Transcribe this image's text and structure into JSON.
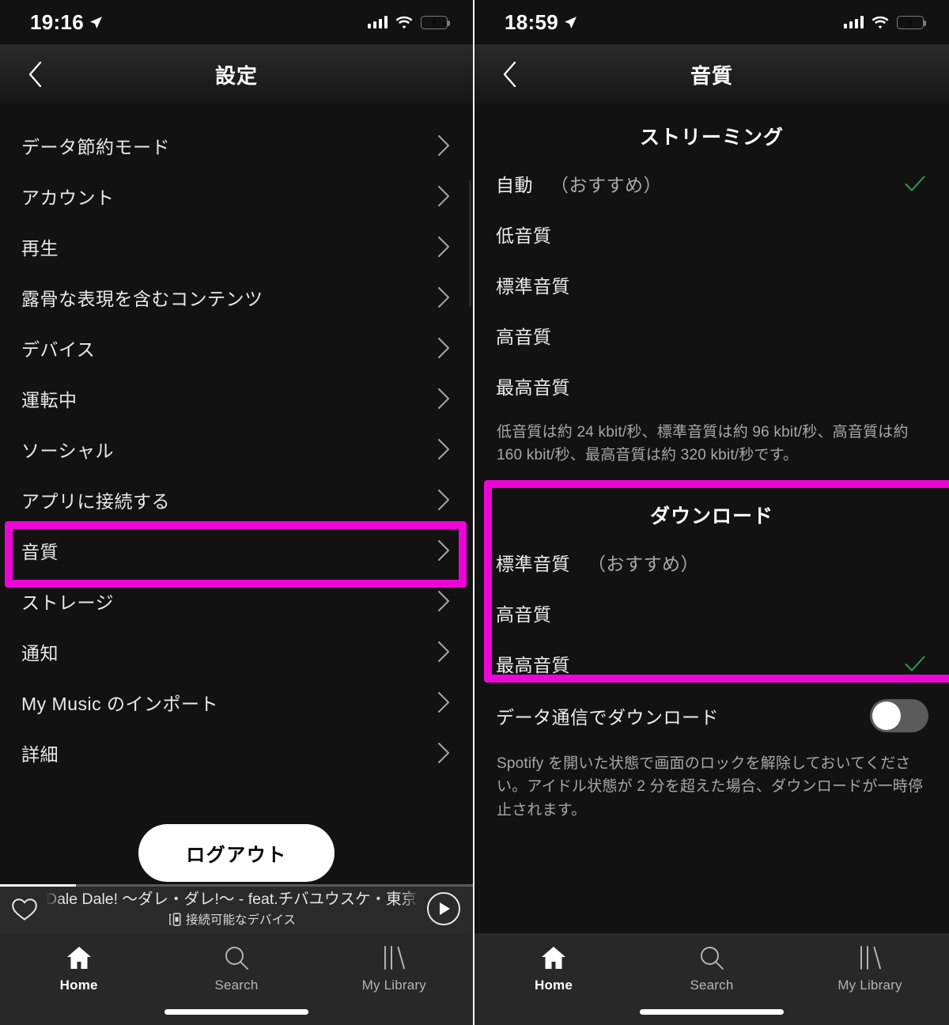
{
  "left": {
    "status": {
      "time": "19:16",
      "location_icon": "location-arrow-icon",
      "signal_icon": "cellular-signal-icon",
      "wifi_icon": "wifi-icon",
      "battery_icon": "battery-charging-icon"
    },
    "nav": {
      "back_icon": "chevron-left-icon",
      "title": "設定"
    },
    "settings_items": [
      {
        "label": "データ節約モード"
      },
      {
        "label": "アカウント"
      },
      {
        "label": "再生"
      },
      {
        "label": "露骨な表現を含むコンテンツ"
      },
      {
        "label": "デバイス"
      },
      {
        "label": "運転中"
      },
      {
        "label": "ソーシャル"
      },
      {
        "label": "アプリに接続する"
      },
      {
        "label": "音質"
      },
      {
        "label": "ストレージ"
      },
      {
        "label": "通知"
      },
      {
        "label": "My Music のインポート"
      },
      {
        "label": "詳細"
      }
    ],
    "highlight": {
      "target_label": "音質",
      "color": "#ec06d6"
    },
    "logout_label": "ログアウト",
    "now_playing": {
      "title": "Dale Dale! 〜ダレ・ダレ!〜 - feat.チバユウスケ・東京スカパ",
      "subtitle": "接続可能なデバイス",
      "device_icon": "connect-device-icon",
      "heart_icon": "heart-outline-icon",
      "play_icon": "play-icon",
      "progress_percent": 16
    },
    "tabs": [
      {
        "label": "Home",
        "icon": "home-icon",
        "active": true
      },
      {
        "label": "Search",
        "icon": "search-icon",
        "active": false
      },
      {
        "label": "My Library",
        "icon": "my-library-icon",
        "active": false
      }
    ]
  },
  "right": {
    "status": {
      "time": "18:59",
      "location_icon": "location-arrow-icon",
      "signal_icon": "cellular-signal-icon",
      "wifi_icon": "wifi-icon",
      "battery_icon": "battery-charging-icon"
    },
    "nav": {
      "back_icon": "chevron-left-icon",
      "title": "音質"
    },
    "streaming": {
      "heading": "ストリーミング",
      "options": [
        {
          "label": "自動",
          "hint": "（おすすめ）",
          "selected": true
        },
        {
          "label": "低音質",
          "hint": "",
          "selected": false
        },
        {
          "label": "標準音質",
          "hint": "",
          "selected": false
        },
        {
          "label": "高音質",
          "hint": "",
          "selected": false
        },
        {
          "label": "最高音質",
          "hint": "",
          "selected": false
        }
      ],
      "description": "低音質は約 24 kbit/秒、標準音質は約 96 kbit/秒、高音質は約 160 kbit/秒、最高音質は約 320 kbit/秒です。"
    },
    "download": {
      "heading": "ダウンロード",
      "options": [
        {
          "label": "標準音質",
          "hint": "（おすすめ）",
          "selected": false
        },
        {
          "label": "高音質",
          "hint": "",
          "selected": false
        },
        {
          "label": "最高音質",
          "hint": "",
          "selected": true
        }
      ],
      "toggle": {
        "label": "データ通信でダウンロード",
        "on": false
      },
      "description": "Spotify を開いた状態で画面のロックを解除しておいてください。アイドル状態が 2 分を超えた場合、ダウンロードが一時停止されます。"
    },
    "highlight": {
      "target_section": "ダウンロード",
      "color": "#ec06d6"
    },
    "tabs": [
      {
        "label": "Home",
        "icon": "home-icon",
        "active": true
      },
      {
        "label": "Search",
        "icon": "search-icon",
        "active": false
      },
      {
        "label": "My Library",
        "icon": "my-library-icon",
        "active": false
      }
    ]
  },
  "colors": {
    "highlight_magenta": "#ec06d6",
    "check_green": "#2f9e4f",
    "battery_green": "#31d158",
    "background": "#121212"
  }
}
